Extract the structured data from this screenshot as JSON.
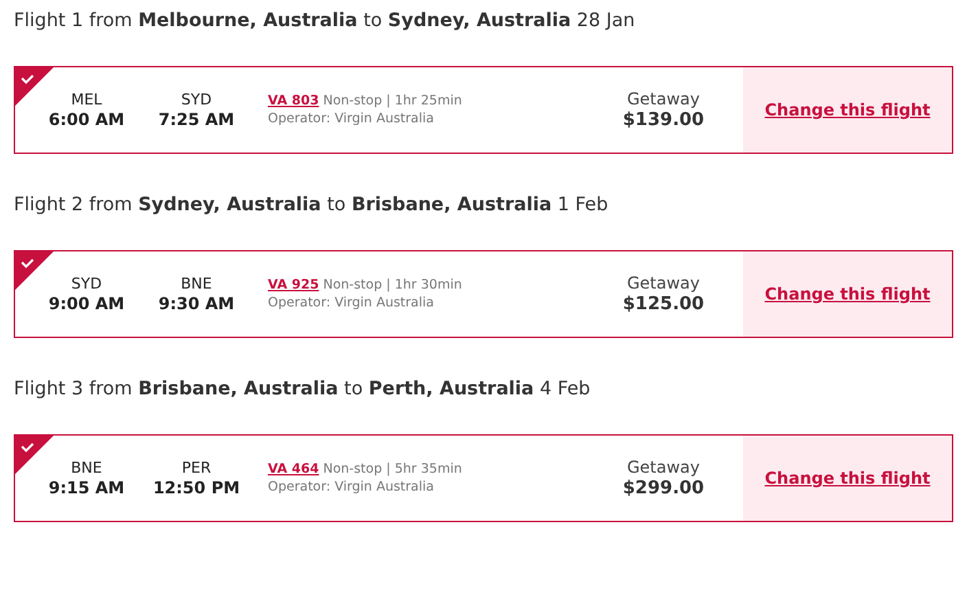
{
  "flights": [
    {
      "heading": "Flight 1 from **Melbourne, Australia** to **Sydney, Australia** 28 Jan",
      "selected": true,
      "from_code": "MEL",
      "depart": "6:00 AM",
      "to_code": "SYD",
      "arrive": "7:25 AM",
      "flight_number": "VA 803",
      "summary": "Non-stop | 1hr 25min",
      "operator": "Operator: Virgin Australia",
      "fare_name": "Getaway",
      "price": "$139.00",
      "action": "Change this flight"
    },
    {
      "heading": "Flight 2 from **Sydney, Australia** to **Brisbane, Australia** 1 Feb",
      "selected": true,
      "from_code": "SYD",
      "depart": "9:00 AM",
      "to_code": "BNE",
      "arrive": "9:30 AM",
      "flight_number": "VA 925",
      "summary": "Non-stop | 1hr 30min",
      "operator": "Operator: Virgin Australia",
      "fare_name": "Getaway",
      "price": "$125.00",
      "action": "Change this flight"
    },
    {
      "heading": "Flight 3 from **Brisbane, Australia** to **Perth, Australia** 4 Feb",
      "selected": true,
      "from_code": "BNE",
      "depart": "9:15 AM",
      "to_code": "PER",
      "arrive": "12:50 PM",
      "flight_number": "VA 464",
      "summary": "Non-stop | 5hr 35min",
      "operator": "Operator: Virgin Australia",
      "fare_name": "Getaway",
      "price": "$299.00",
      "action": "Change this flight"
    }
  ]
}
